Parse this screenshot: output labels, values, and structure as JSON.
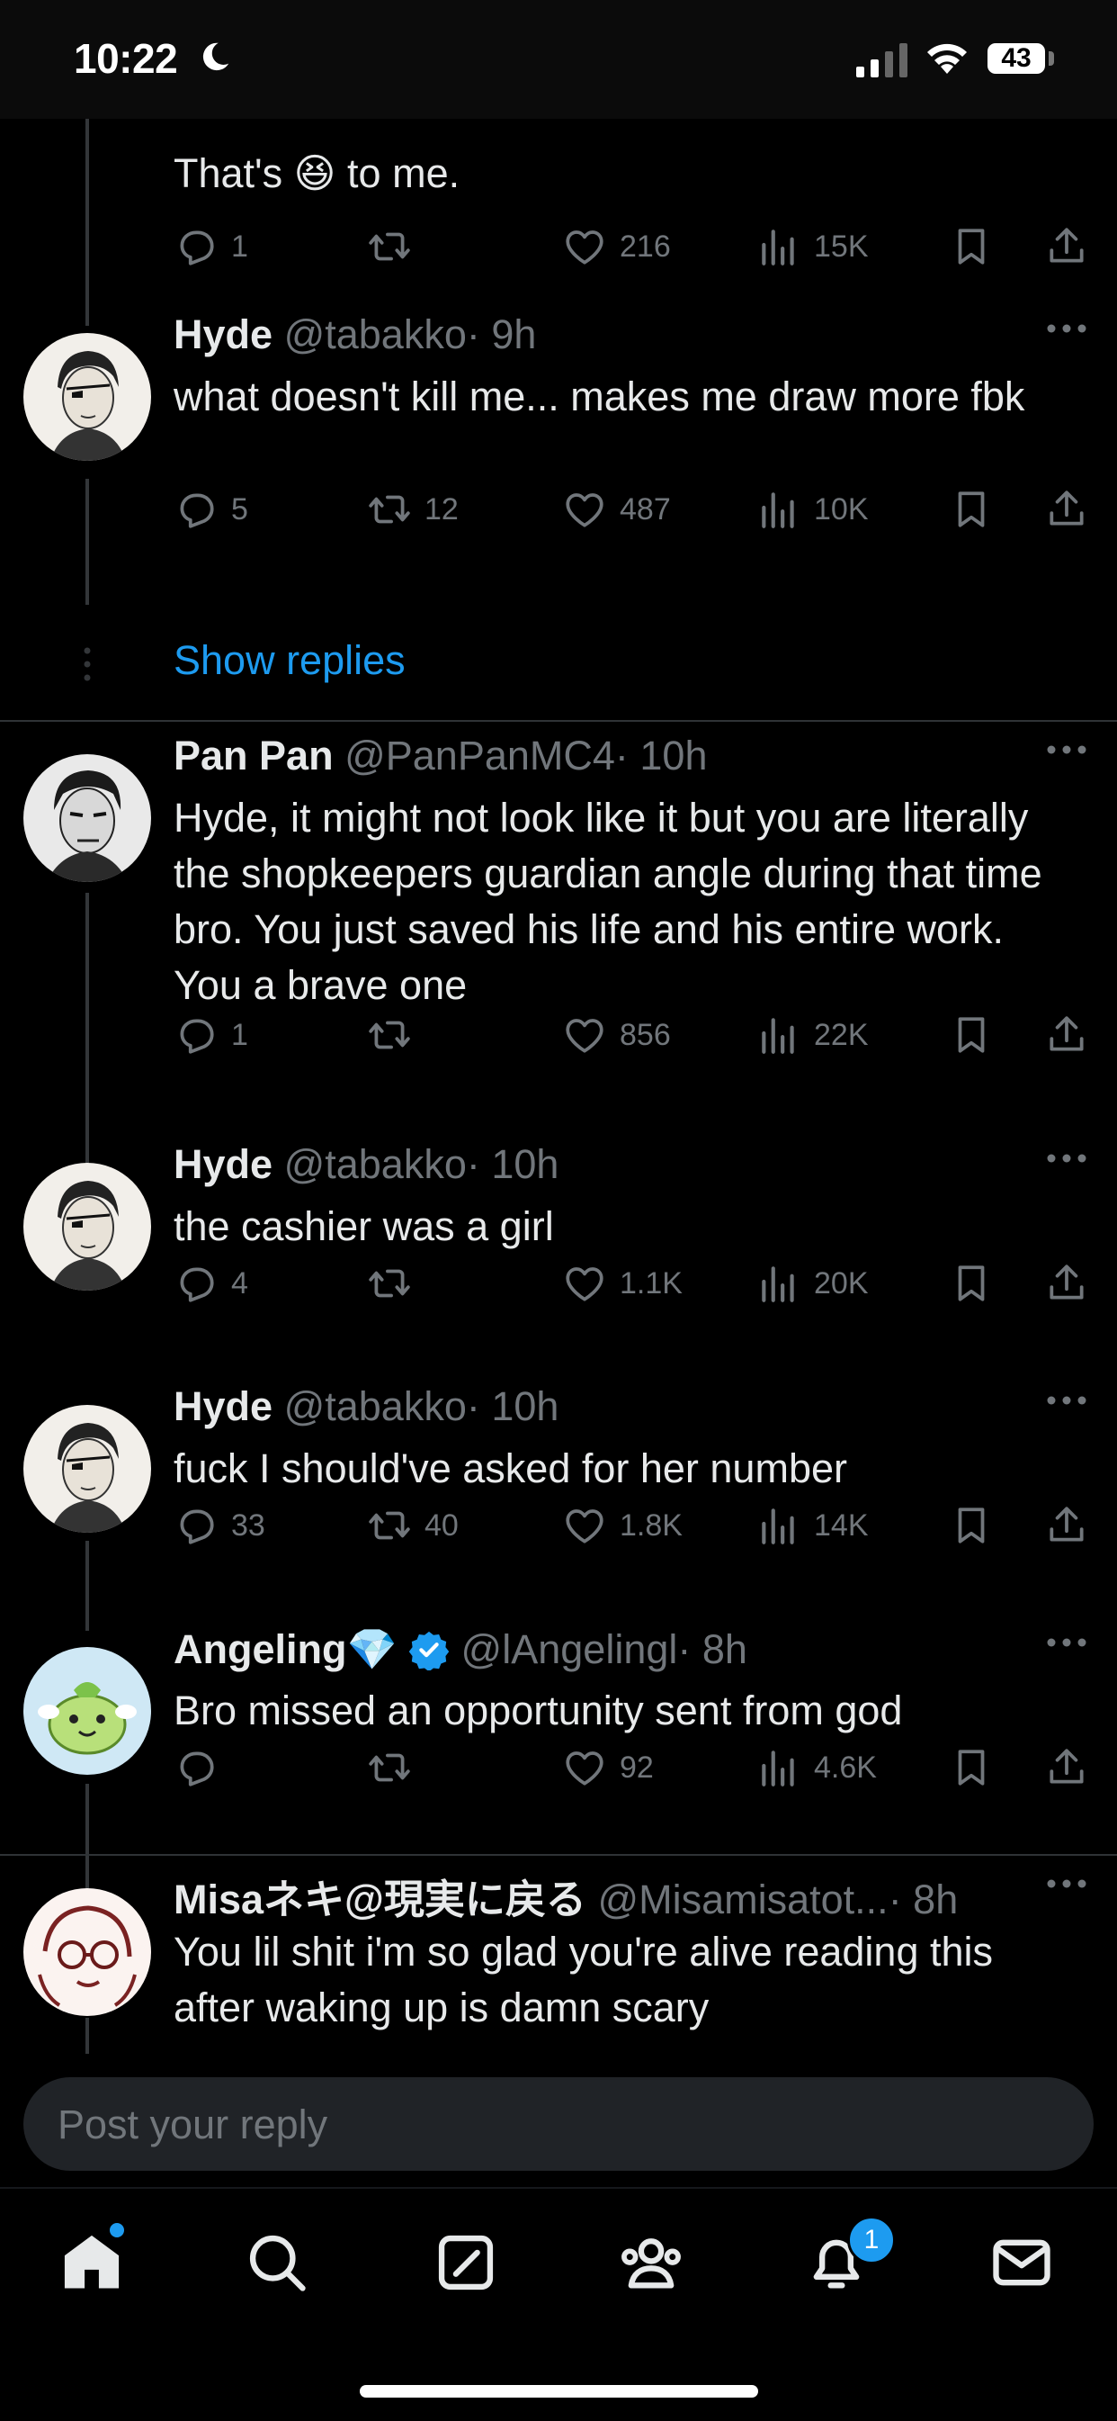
{
  "status_bar": {
    "time": "10:22",
    "battery": "43"
  },
  "colors": {
    "accent": "#1d9bf0",
    "text": "#e7e9ea",
    "muted": "#71767b",
    "background": "#000000"
  },
  "tweets": [
    {
      "text": "That's 😆 to me.",
      "reply_count": "1",
      "retweet_count": "",
      "like_count": "216",
      "view_count": "15K"
    },
    {
      "name": "Hyde",
      "handle": "@tabakko",
      "time": "· 9h",
      "text": "what doesn't kill me... makes me draw more fbk",
      "reply_count": "5",
      "retweet_count": "12",
      "like_count": "487",
      "view_count": "10K"
    },
    {
      "name": "Pan Pan",
      "handle": "@PanPanMC4",
      "time": "· 10h",
      "text": "Hyde, it might not look like it but you are literally the shopkeepers guardian angle during that time bro. You just saved his life and his entire work. You a brave one",
      "reply_count": "1",
      "retweet_count": "",
      "like_count": "856",
      "view_count": "22K"
    },
    {
      "name": "Hyde",
      "handle": "@tabakko",
      "time": "· 10h",
      "text": "the cashier was a girl",
      "reply_count": "4",
      "retweet_count": "",
      "like_count": "1.1K",
      "view_count": "20K"
    },
    {
      "name": "Hyde",
      "handle": "@tabakko",
      "time": "· 10h",
      "text": "fuck I should've asked for her number",
      "reply_count": "33",
      "retweet_count": "40",
      "like_count": "1.8K",
      "view_count": "14K"
    },
    {
      "name": "Angeling💎",
      "handle": "@lAngelingl",
      "time": "· 8h",
      "text": "Bro missed an opportunity sent from god",
      "reply_count": "",
      "retweet_count": "",
      "like_count": "92",
      "view_count": "4.6K"
    },
    {
      "name": "Misaネキ@現実に戻る",
      "handle": "@Misamisatot...",
      "time": "· 8h",
      "text": "You lil shit i'm so glad you're alive reading this after waking up is damn scary"
    }
  ],
  "show_replies": "Show replies",
  "reply_box": {
    "placeholder": "Post your reply"
  },
  "tabbar": {
    "notification_count": "1"
  },
  "icons": [
    "moon-icon",
    "signal-icon",
    "wifi-icon",
    "battery-icon",
    "reply-icon",
    "retweet-icon",
    "like-icon",
    "views-icon",
    "bookmark-icon",
    "share-icon",
    "more-icon",
    "verified-icon",
    "home-icon",
    "search-icon",
    "compose-icon",
    "communities-icon",
    "notifications-icon",
    "messages-icon"
  ]
}
